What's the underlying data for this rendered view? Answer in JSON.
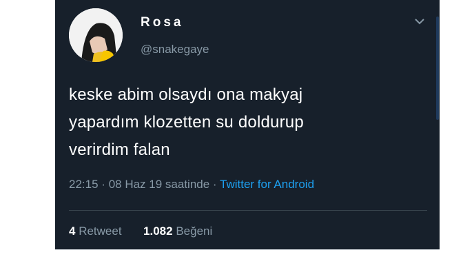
{
  "tweet": {
    "display_name": "Rosa",
    "handle": "@snakegaye",
    "text_lines": [
      "keske abim olsaydı ona makyaj",
      "yapardım klozetten su doldurup",
      "verirdim falan"
    ],
    "time": "22:15",
    "date": "08 Haz 19 saatinde",
    "separator": "·",
    "source": "Twitter for Android"
  },
  "stats": {
    "retweet_count": "4",
    "retweet_label": "Retweet",
    "like_count": "1.082",
    "like_label": "Beğeni"
  },
  "colors": {
    "background": "#17202b",
    "text": "#ffffff",
    "secondary": "#8899a6",
    "accent": "#1da1f2"
  },
  "icons": {
    "menu": "chevron-down-icon"
  }
}
